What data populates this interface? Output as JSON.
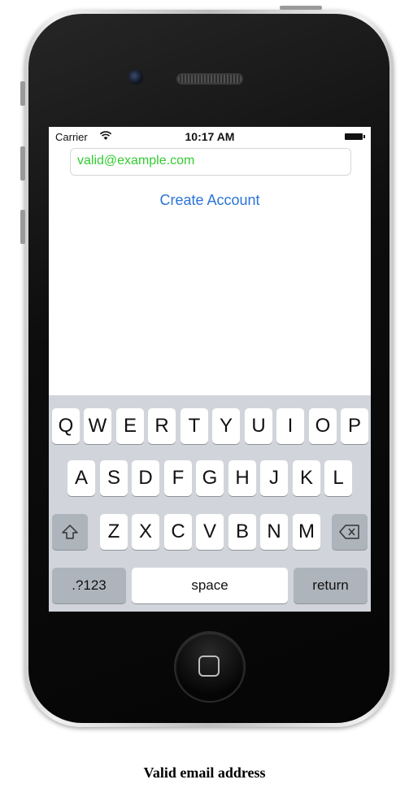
{
  "status_bar": {
    "carrier": "Carrier",
    "time": "10:17 AM"
  },
  "form": {
    "email_value": "valid@example.com",
    "create_account_label": "Create Account"
  },
  "keyboard": {
    "row1": [
      "Q",
      "W",
      "E",
      "R",
      "T",
      "Y",
      "U",
      "I",
      "O",
      "P"
    ],
    "row2": [
      "A",
      "S",
      "D",
      "F",
      "G",
      "H",
      "J",
      "K",
      "L"
    ],
    "row3": [
      "Z",
      "X",
      "C",
      "V",
      "B",
      "N",
      "M"
    ],
    "numbers_label": ".?123",
    "space_label": "space",
    "return_label": "return"
  },
  "caption": "Valid email address",
  "colors": {
    "email_text": "#33cc33",
    "link_blue": "#2b74d6"
  }
}
